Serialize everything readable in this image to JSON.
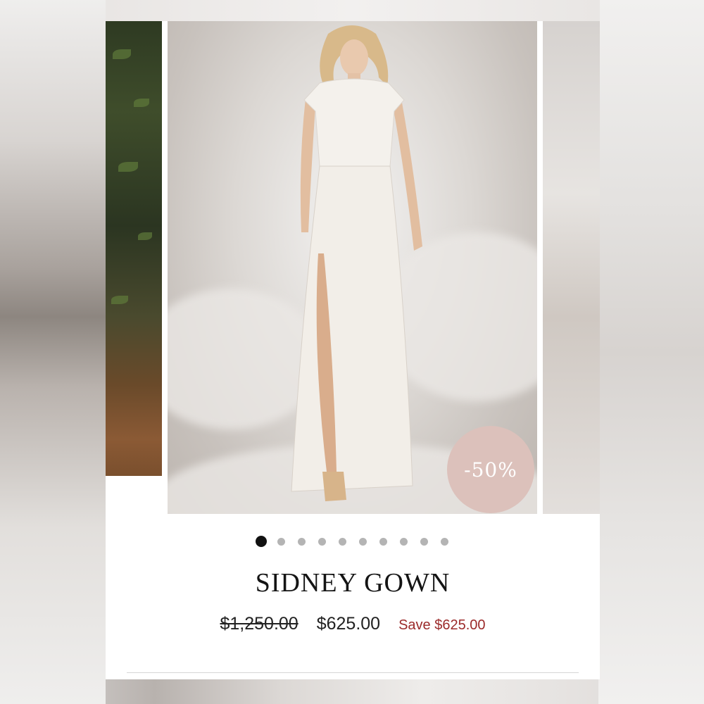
{
  "product": {
    "title": "SIDNEY GOWN",
    "original_price": "$1,250.00",
    "sale_price": "$625.00",
    "savings": "Save $625.00",
    "discount_badge": "-50%"
  },
  "carousel": {
    "image_count": 10,
    "active_index": 0,
    "main_image": "model-in-white-satin-gown-photo"
  },
  "colors": {
    "badge": "#dcc1bb",
    "save_text": "#9b2a2a",
    "active_dot": "#111111",
    "inactive_dot": "#b4b4b4"
  }
}
